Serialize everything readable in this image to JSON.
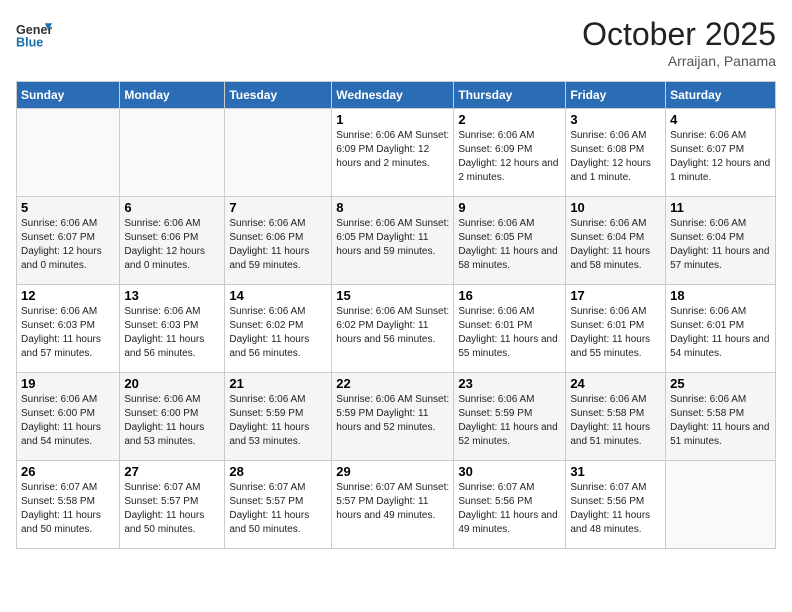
{
  "header": {
    "logo_general": "General",
    "logo_blue": "Blue",
    "month_title": "October 2025",
    "subtitle": "Arraijan, Panama"
  },
  "days_of_week": [
    "Sunday",
    "Monday",
    "Tuesday",
    "Wednesday",
    "Thursday",
    "Friday",
    "Saturday"
  ],
  "weeks": [
    [
      {
        "day": "",
        "info": ""
      },
      {
        "day": "",
        "info": ""
      },
      {
        "day": "",
        "info": ""
      },
      {
        "day": "1",
        "info": "Sunrise: 6:06 AM\nSunset: 6:09 PM\nDaylight: 12 hours and 2 minutes."
      },
      {
        "day": "2",
        "info": "Sunrise: 6:06 AM\nSunset: 6:09 PM\nDaylight: 12 hours and 2 minutes."
      },
      {
        "day": "3",
        "info": "Sunrise: 6:06 AM\nSunset: 6:08 PM\nDaylight: 12 hours and 1 minute."
      },
      {
        "day": "4",
        "info": "Sunrise: 6:06 AM\nSunset: 6:07 PM\nDaylight: 12 hours and 1 minute."
      }
    ],
    [
      {
        "day": "5",
        "info": "Sunrise: 6:06 AM\nSunset: 6:07 PM\nDaylight: 12 hours and 0 minutes."
      },
      {
        "day": "6",
        "info": "Sunrise: 6:06 AM\nSunset: 6:06 PM\nDaylight: 12 hours and 0 minutes."
      },
      {
        "day": "7",
        "info": "Sunrise: 6:06 AM\nSunset: 6:06 PM\nDaylight: 11 hours and 59 minutes."
      },
      {
        "day": "8",
        "info": "Sunrise: 6:06 AM\nSunset: 6:05 PM\nDaylight: 11 hours and 59 minutes."
      },
      {
        "day": "9",
        "info": "Sunrise: 6:06 AM\nSunset: 6:05 PM\nDaylight: 11 hours and 58 minutes."
      },
      {
        "day": "10",
        "info": "Sunrise: 6:06 AM\nSunset: 6:04 PM\nDaylight: 11 hours and 58 minutes."
      },
      {
        "day": "11",
        "info": "Sunrise: 6:06 AM\nSunset: 6:04 PM\nDaylight: 11 hours and 57 minutes."
      }
    ],
    [
      {
        "day": "12",
        "info": "Sunrise: 6:06 AM\nSunset: 6:03 PM\nDaylight: 11 hours and 57 minutes."
      },
      {
        "day": "13",
        "info": "Sunrise: 6:06 AM\nSunset: 6:03 PM\nDaylight: 11 hours and 56 minutes."
      },
      {
        "day": "14",
        "info": "Sunrise: 6:06 AM\nSunset: 6:02 PM\nDaylight: 11 hours and 56 minutes."
      },
      {
        "day": "15",
        "info": "Sunrise: 6:06 AM\nSunset: 6:02 PM\nDaylight: 11 hours and 56 minutes."
      },
      {
        "day": "16",
        "info": "Sunrise: 6:06 AM\nSunset: 6:01 PM\nDaylight: 11 hours and 55 minutes."
      },
      {
        "day": "17",
        "info": "Sunrise: 6:06 AM\nSunset: 6:01 PM\nDaylight: 11 hours and 55 minutes."
      },
      {
        "day": "18",
        "info": "Sunrise: 6:06 AM\nSunset: 6:01 PM\nDaylight: 11 hours and 54 minutes."
      }
    ],
    [
      {
        "day": "19",
        "info": "Sunrise: 6:06 AM\nSunset: 6:00 PM\nDaylight: 11 hours and 54 minutes."
      },
      {
        "day": "20",
        "info": "Sunrise: 6:06 AM\nSunset: 6:00 PM\nDaylight: 11 hours and 53 minutes."
      },
      {
        "day": "21",
        "info": "Sunrise: 6:06 AM\nSunset: 5:59 PM\nDaylight: 11 hours and 53 minutes."
      },
      {
        "day": "22",
        "info": "Sunrise: 6:06 AM\nSunset: 5:59 PM\nDaylight: 11 hours and 52 minutes."
      },
      {
        "day": "23",
        "info": "Sunrise: 6:06 AM\nSunset: 5:59 PM\nDaylight: 11 hours and 52 minutes."
      },
      {
        "day": "24",
        "info": "Sunrise: 6:06 AM\nSunset: 5:58 PM\nDaylight: 11 hours and 51 minutes."
      },
      {
        "day": "25",
        "info": "Sunrise: 6:06 AM\nSunset: 5:58 PM\nDaylight: 11 hours and 51 minutes."
      }
    ],
    [
      {
        "day": "26",
        "info": "Sunrise: 6:07 AM\nSunset: 5:58 PM\nDaylight: 11 hours and 50 minutes."
      },
      {
        "day": "27",
        "info": "Sunrise: 6:07 AM\nSunset: 5:57 PM\nDaylight: 11 hours and 50 minutes."
      },
      {
        "day": "28",
        "info": "Sunrise: 6:07 AM\nSunset: 5:57 PM\nDaylight: 11 hours and 50 minutes."
      },
      {
        "day": "29",
        "info": "Sunrise: 6:07 AM\nSunset: 5:57 PM\nDaylight: 11 hours and 49 minutes."
      },
      {
        "day": "30",
        "info": "Sunrise: 6:07 AM\nSunset: 5:56 PM\nDaylight: 11 hours and 49 minutes."
      },
      {
        "day": "31",
        "info": "Sunrise: 6:07 AM\nSunset: 5:56 PM\nDaylight: 11 hours and 48 minutes."
      },
      {
        "day": "",
        "info": ""
      }
    ]
  ]
}
